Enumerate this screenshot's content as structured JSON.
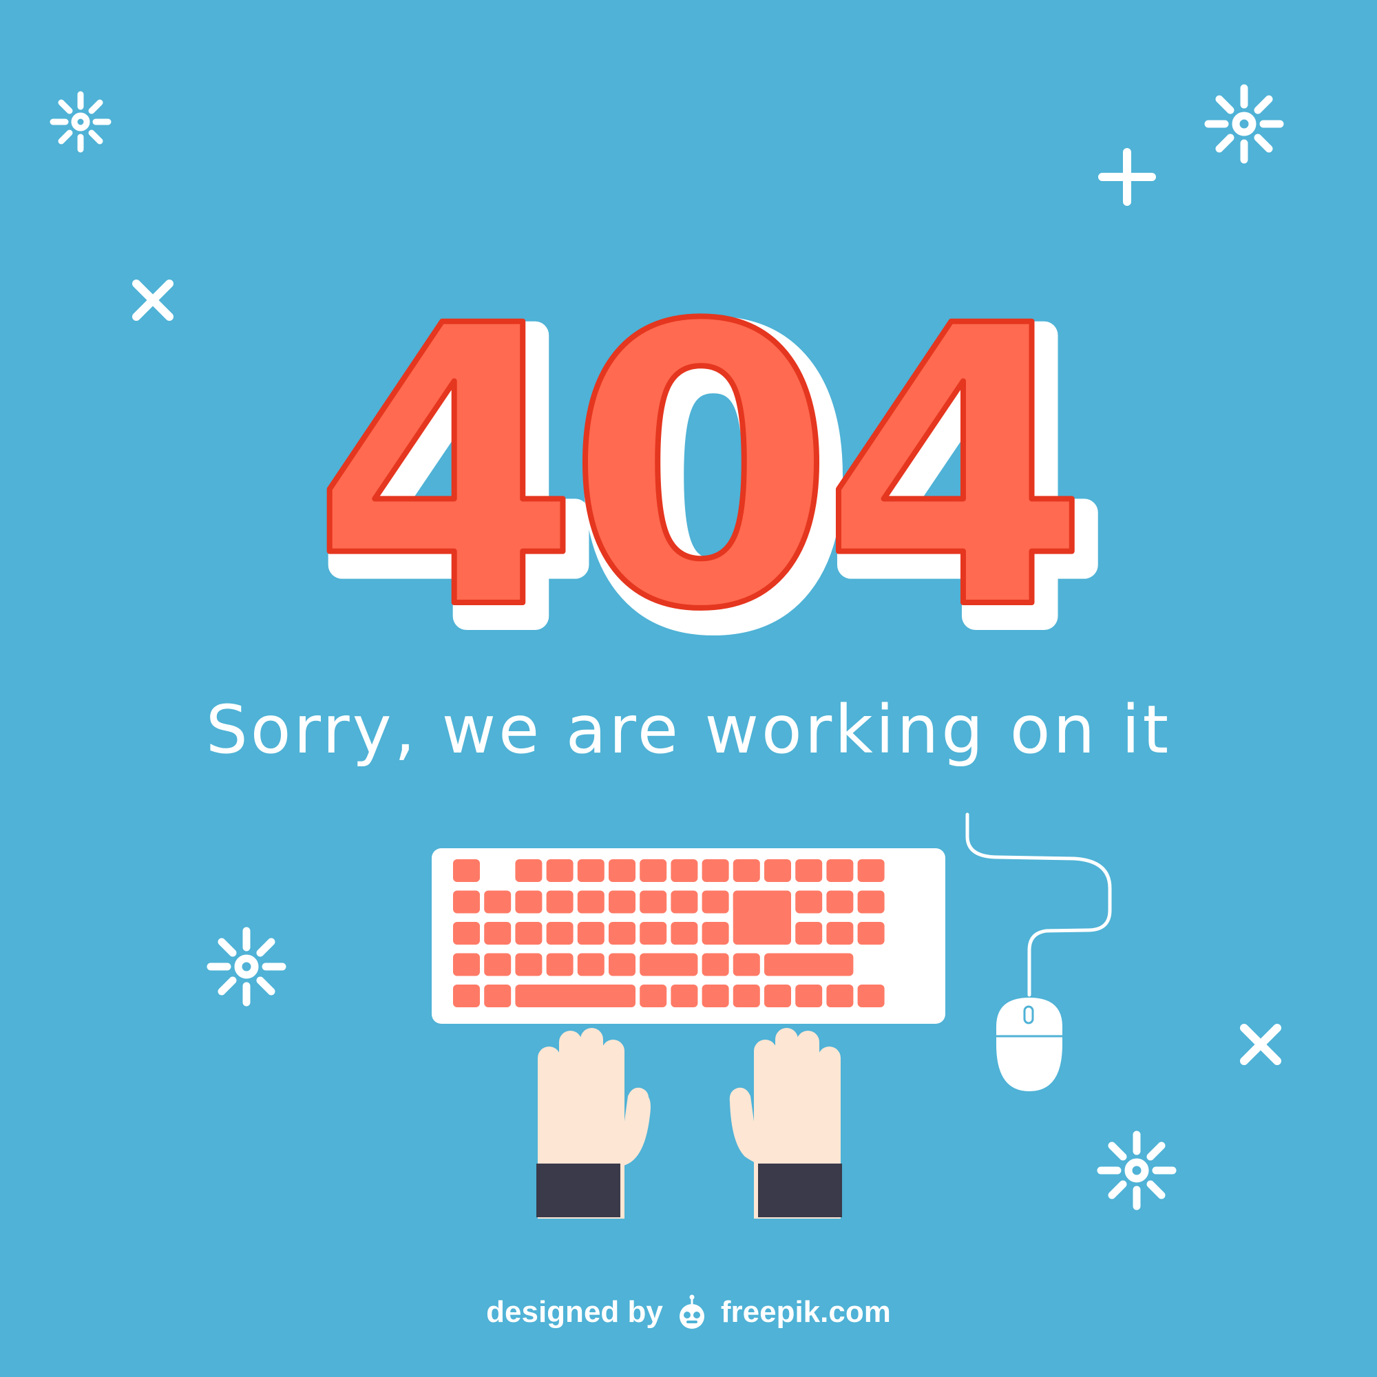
{
  "error_code": "404",
  "message": "Sorry, we are working on it",
  "credit": {
    "prefix": "designed by",
    "brand": "freepik.com"
  },
  "colors": {
    "background": "#4fb2d6",
    "digit_fill": "#ff6a50",
    "digit_outline": "#e5361f",
    "key_fill": "#ff7a66",
    "skin": "#fde6d4",
    "sleeve": "#3a3a4a",
    "white": "#ffffff"
  },
  "icons": [
    "sparkle-icon",
    "plus-icon",
    "cross-icon",
    "keyboard-icon",
    "mouse-icon",
    "hands-icon",
    "freepik-logo-icon"
  ]
}
